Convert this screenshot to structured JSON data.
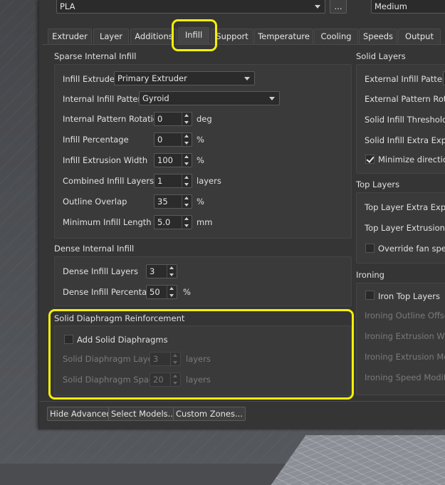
{
  "top": {
    "material_value": "PLA",
    "browse_label": "...",
    "quality_value": "Medium"
  },
  "tabs": [
    "Extruder",
    "Layer",
    "Additions",
    "Infill",
    "Support",
    "Temperature",
    "Cooling",
    "Speeds",
    "Output"
  ],
  "sparse": {
    "title": "Sparse Internal Infill",
    "extruder_label": "Infill Extruder",
    "extruder_value": "Primary Extruder",
    "pattern_label": "Internal Infill Pattern",
    "pattern_value": "Gyroid",
    "rotation_label": "Internal Pattern Rotation",
    "rotation_value": "0",
    "rotation_unit": "deg",
    "percentage_label": "Infill Percentage",
    "percentage_value": "0",
    "percentage_unit": "%",
    "width_label": "Infill Extrusion Width",
    "width_value": "100",
    "width_unit": "%",
    "combined_label": "Combined Infill Layers",
    "combined_value": "1",
    "combined_unit": "layers",
    "overlap_label": "Outline Overlap",
    "overlap_value": "35",
    "overlap_unit": "%",
    "minlen_label": "Minimum Infill Length",
    "minlen_value": "5.0",
    "minlen_unit": "mm"
  },
  "dense": {
    "title": "Dense Internal Infill",
    "layers_label": "Dense Infill Layers",
    "layers_value": "3",
    "percentage_label": "Dense Infill Percentage",
    "percentage_value": "50",
    "percentage_unit": "%"
  },
  "diaphragm": {
    "title": "Solid Diaphragm Reinforcement",
    "add_label": "Add Solid Diaphragms",
    "layers_label": "Solid Diaphragm Layers",
    "layers_value": "3",
    "layers_unit": "layers",
    "spacing_label": "Solid Diaphragm Spacing",
    "spacing_value": "20",
    "spacing_unit": "layers"
  },
  "solid": {
    "title": "Solid Layers",
    "external_pattern": "External Infill Pattern",
    "external_rotation": "External Pattern Rotatio",
    "threshold": "Solid Infill Threshold Are",
    "extra_expansion": "Solid Infill Extra Expansi",
    "minimize": "Minimize direction ch"
  },
  "top_layers": {
    "title": "Top Layers",
    "extra_expansion": "Top Layer Extra Expans",
    "extrusion_mode": "Top Layer Extrusion Mo",
    "override_fan": "Override fan speed"
  },
  "ironing": {
    "title": "Ironing",
    "iron_top": "Iron Top Layers",
    "outline_offset": "Ironing Outline Offset",
    "extrusion_width": "Ironing Extrusion Width",
    "extrusion_modifier": "Ironing Extrusion Modif",
    "speed_modifier": "Ironing Speed Modifier"
  },
  "buttons": {
    "hide_advanced": "Hide Advanced",
    "select_models": "Select Models...",
    "custom_zones": "Custom Zones..."
  },
  "colors": {
    "highlight": "#f5f000",
    "panel": "#353535"
  }
}
